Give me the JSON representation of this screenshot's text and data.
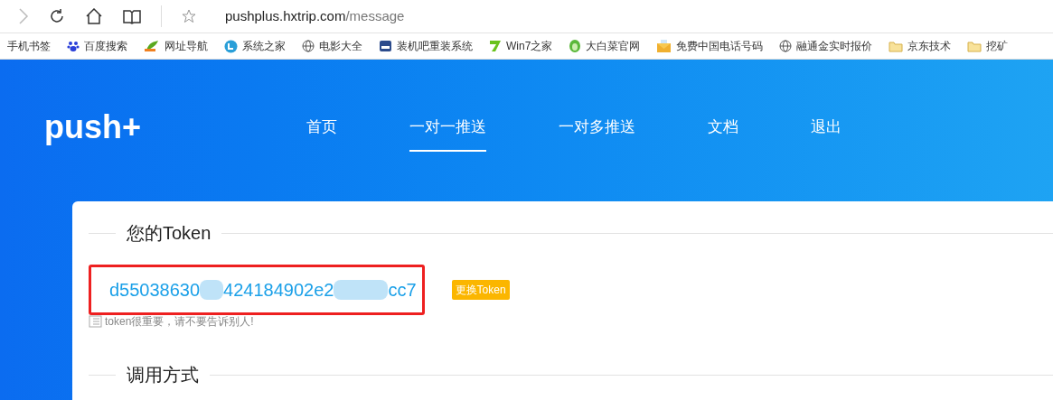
{
  "browser": {
    "url_host": "pushplus.hxtrip.com",
    "url_path": "/message"
  },
  "bookmarks": [
    {
      "label": "手机书签",
      "kind": "none"
    },
    {
      "label": "百度搜索",
      "kind": "paw"
    },
    {
      "label": "网址导航",
      "kind": "leaf"
    },
    {
      "label": "系统之家",
      "kind": "circle"
    },
    {
      "label": "电影大全",
      "kind": "globe"
    },
    {
      "label": "装机吧重装系统",
      "kind": "box"
    },
    {
      "label": "Win7之家",
      "kind": "seven"
    },
    {
      "label": "大白菜官网",
      "kind": "cabbage"
    },
    {
      "label": "免费中国电话号码",
      "kind": "mail"
    },
    {
      "label": "融通金实时报价",
      "kind": "globe"
    },
    {
      "label": "京东技术",
      "kind": "folder"
    },
    {
      "label": "挖矿",
      "kind": "folder"
    }
  ],
  "logo": "push+",
  "nav": [
    {
      "label": "首页",
      "selected": false
    },
    {
      "label": "一对一推送",
      "selected": true
    },
    {
      "label": "一对多推送",
      "selected": false
    },
    {
      "label": "文档",
      "selected": false
    },
    {
      "label": "退出",
      "selected": false
    }
  ],
  "token_section": {
    "title": "您的Token",
    "token_parts": [
      "d55038630",
      "424184902e2",
      "cc7"
    ],
    "change_button": "更换Token",
    "hint": "token很重要，请不要告诉别人!"
  },
  "usage_section": {
    "title": "调用方式"
  }
}
